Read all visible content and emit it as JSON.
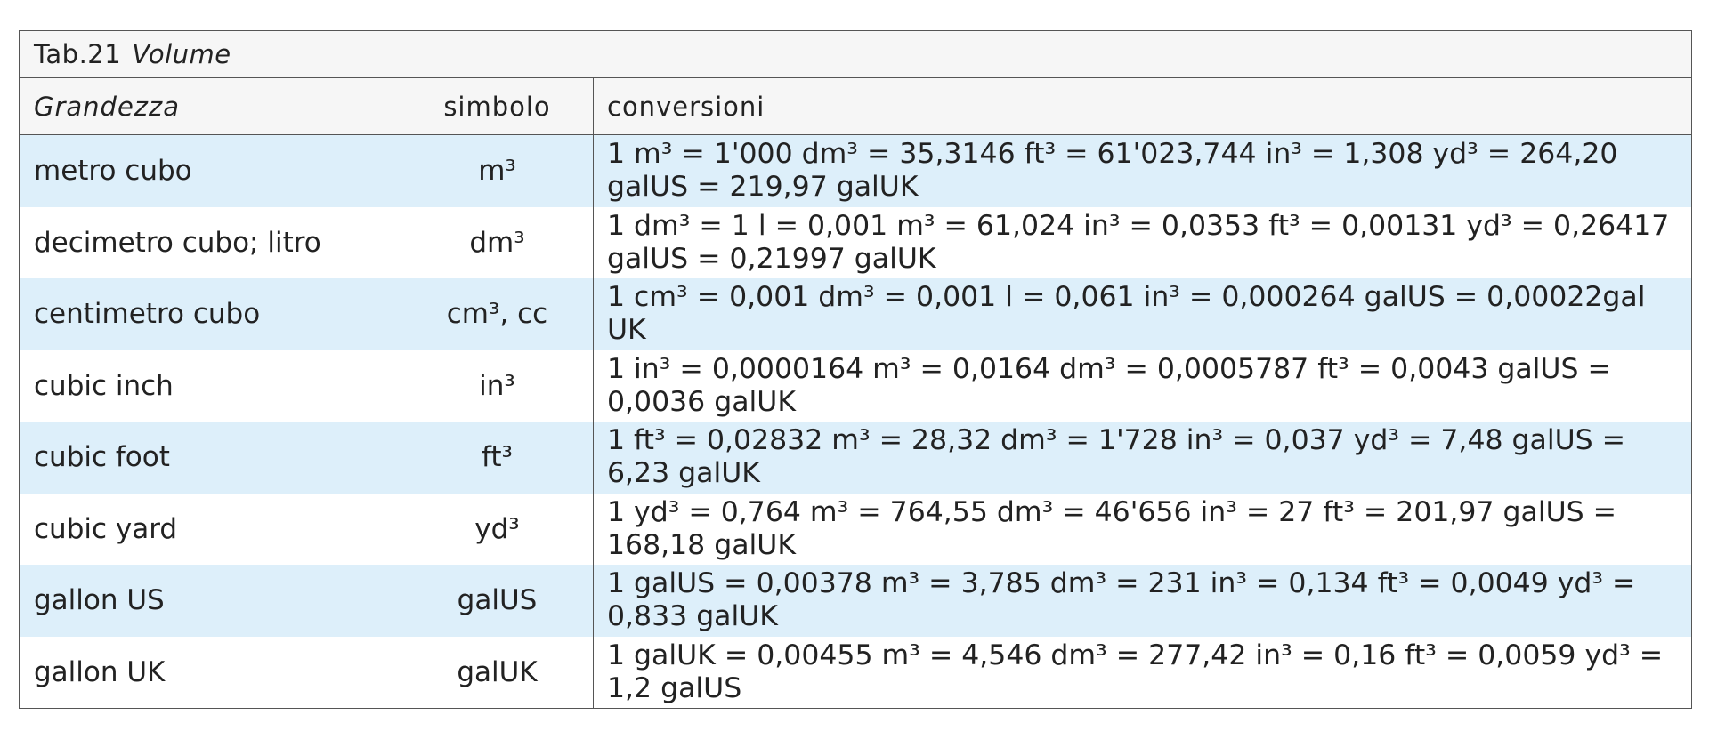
{
  "table": {
    "caption_prefix": "Tab.21",
    "caption_title": "Volume",
    "headers": {
      "quantity": "Grandezza",
      "symbol": "simbolo",
      "conversions": "conversioni"
    },
    "rows": [
      {
        "quantity": "metro cubo",
        "symbol": "m³",
        "conversions": "1 m³ = 1'000 dm³ = 35,3146 ft³ = 61'023,744 in³ = 1,308 yd³ = 264,20 galUS = 219,97 galUK"
      },
      {
        "quantity": "decimetro cubo; litro",
        "symbol": "dm³",
        "conversions": "1 dm³ = 1 l = 0,001 m³ = 61,024 in³ = 0,0353 ft³ = 0,00131 yd³ = 0,26417 galUS = 0,21997 galUK"
      },
      {
        "quantity": "centimetro cubo",
        "symbol": "cm³, cc",
        "conversions": "1 cm³ = 0,001 dm³ = 0,001 l = 0,061 in³ = 0,000264 galUS = 0,00022gal UK"
      },
      {
        "quantity": "cubic inch",
        "symbol": "in³",
        "conversions": "1 in³ = 0,0000164 m³ = 0,0164 dm³ = 0,0005787 ft³ = 0,0043 galUS = 0,0036 galUK"
      },
      {
        "quantity": "cubic foot",
        "symbol": "ft³",
        "conversions": "1 ft³ = 0,02832 m³ = 28,32 dm³ = 1'728 in³ = 0,037 yd³ = 7,48 galUS = 6,23 galUK"
      },
      {
        "quantity": "cubic yard",
        "symbol": "yd³",
        "conversions": "1 yd³ = 0,764 m³ = 764,55 dm³ = 46'656 in³ = 27 ft³ = 201,97 galUS = 168,18 galUK"
      },
      {
        "quantity": "gallon US",
        "symbol": "galUS",
        "conversions": "1 galUS = 0,00378 m³ = 3,785 dm³ = 231 in³ = 0,134 ft³ = 0,0049 yd³ = 0,833 galUK"
      },
      {
        "quantity": "gallon UK",
        "symbol": "galUK",
        "conversions": "1 galUK = 0,00455 m³ = 4,546 dm³ = 277,42 in³ = 0,16 ft³ = 0,0059 yd³ = 1,2 galUS"
      }
    ]
  },
  "colors": {
    "header_background": "#f6f6f6",
    "row_highlight": "#ddeffa",
    "border": "#555555",
    "text": "#222222"
  }
}
